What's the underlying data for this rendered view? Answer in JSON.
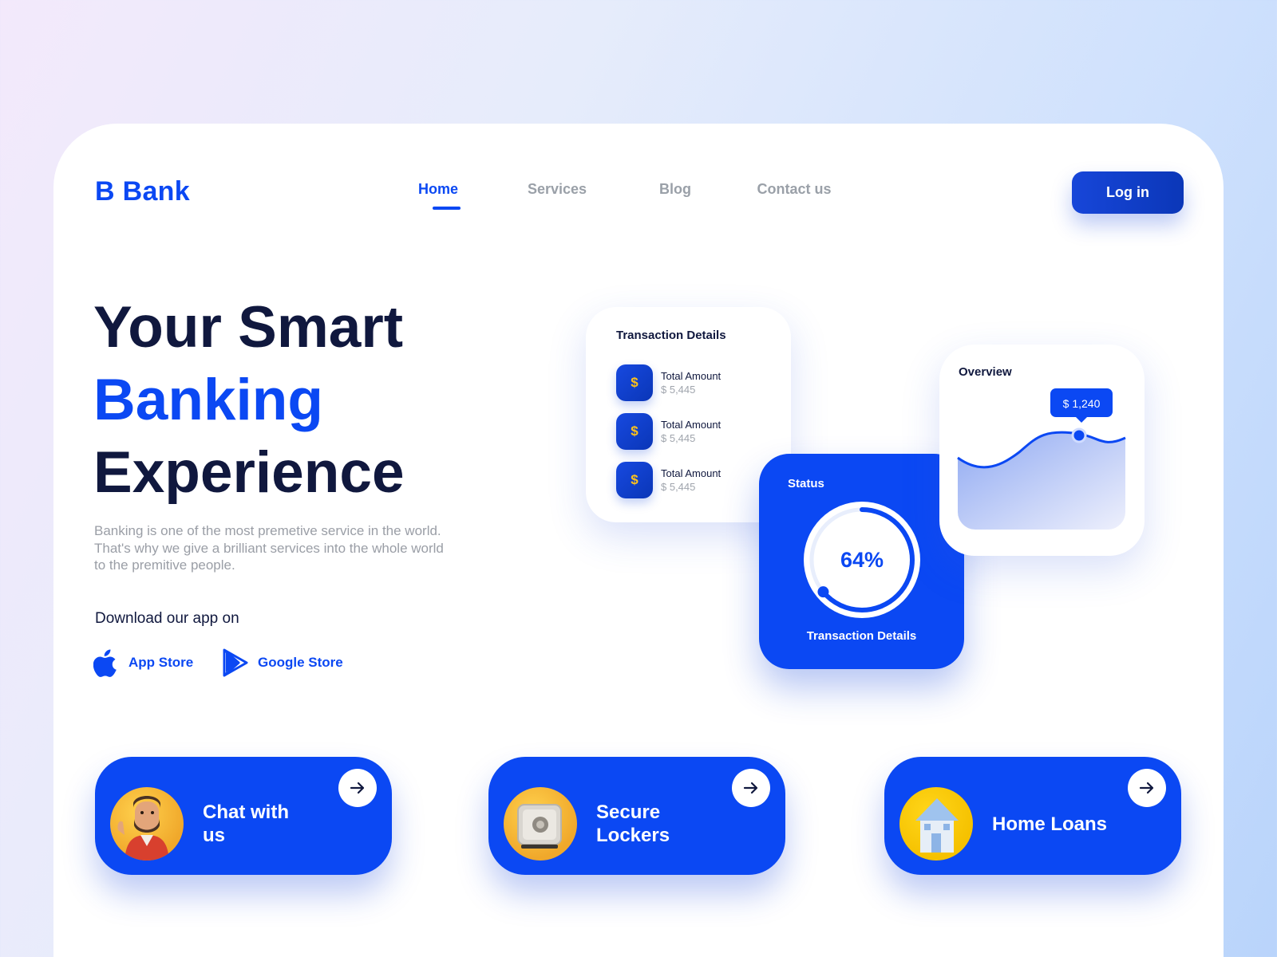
{
  "brand": {
    "logo": "B Bank",
    "accent": "#0b48f3",
    "navy": "#10183e"
  },
  "nav": {
    "items": [
      {
        "label": "Home",
        "active": true
      },
      {
        "label": "Services",
        "active": false
      },
      {
        "label": "Blog",
        "active": false
      },
      {
        "label": "Contact us",
        "active": false
      }
    ],
    "login_label": "Log in"
  },
  "hero": {
    "line1": "Your Smart",
    "line2": "Banking",
    "line3": "Experience",
    "description": "Banking is one of the most premetive service in the world. That's why we give a brilliant services into the whole world to the premitive people.",
    "download_label": "Download our app on",
    "stores": [
      {
        "label": "App Store",
        "icon": "apple-icon"
      },
      {
        "label": "Google Store",
        "icon": "google-play-icon"
      }
    ]
  },
  "transaction_card": {
    "title": "Transaction Details",
    "rows": [
      {
        "icon": "$",
        "label": "Total Amount",
        "value": "$ 5,445"
      },
      {
        "icon": "$",
        "label": "Total Amount",
        "value": "$ 5,445"
      },
      {
        "icon": "$",
        "label": "Total Amount",
        "value": "$ 5,445"
      }
    ]
  },
  "status_card": {
    "title": "Status",
    "percent_label": "64%",
    "progress": 0.64,
    "subtitle": "Transaction Details"
  },
  "overview_card": {
    "title": "Overview",
    "tooltip": "$ 1,240"
  },
  "features": [
    {
      "label_line1": "Chat with",
      "label_line2": "us",
      "icon": "chat-avatar-icon"
    },
    {
      "label_line1": "Secure",
      "label_line2": "Lockers",
      "icon": "locker-safe-icon"
    },
    {
      "label_line1": "Home Loans",
      "label_line2": "",
      "icon": "house-icon"
    }
  ]
}
